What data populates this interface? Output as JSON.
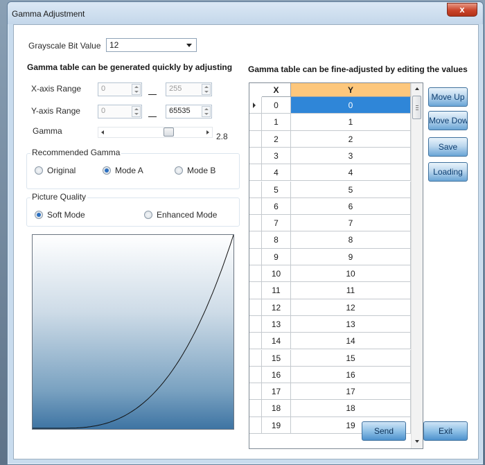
{
  "window": {
    "title": "Gamma Adjustment",
    "close_symbol": "x"
  },
  "grayscale": {
    "label": "Grayscale Bit Value",
    "value": "12"
  },
  "left_heading": "Gamma table can be generated quickly by adjusting",
  "x_axis": {
    "label": "X-axis Range",
    "min": "0",
    "max": "255"
  },
  "y_axis": {
    "label": "Y-axis Range",
    "min": "0",
    "max": "65535"
  },
  "gamma": {
    "label": "Gamma",
    "value": "2.8",
    "slider_fraction": 0.61
  },
  "recommended": {
    "title": "Recommended Gamma",
    "options": [
      {
        "label": "Original",
        "selected": false
      },
      {
        "label": "Mode A",
        "selected": true
      },
      {
        "label": "Mode B",
        "selected": false
      }
    ]
  },
  "quality": {
    "title": "Picture Quality",
    "options": [
      {
        "label": "Soft Mode",
        "selected": true
      },
      {
        "label": "Enhanced Mode",
        "selected": false
      }
    ]
  },
  "right_heading": "Gamma table can be fine-adjusted by editing the values",
  "table": {
    "headers": [
      "X",
      "Y"
    ],
    "rows": [
      [
        "0",
        "0"
      ],
      [
        "1",
        "1"
      ],
      [
        "2",
        "2"
      ],
      [
        "3",
        "3"
      ],
      [
        "4",
        "4"
      ],
      [
        "5",
        "5"
      ],
      [
        "6",
        "6"
      ],
      [
        "7",
        "7"
      ],
      [
        "8",
        "8"
      ],
      [
        "9",
        "9"
      ],
      [
        "10",
        "10"
      ],
      [
        "11",
        "11"
      ],
      [
        "12",
        "12"
      ],
      [
        "13",
        "13"
      ],
      [
        "14",
        "14"
      ],
      [
        "15",
        "15"
      ],
      [
        "16",
        "16"
      ],
      [
        "17",
        "17"
      ],
      [
        "18",
        "18"
      ],
      [
        "19",
        "19"
      ]
    ]
  },
  "side_buttons": {
    "move_up": "Move Up",
    "move_down": "Move Down",
    "save": "Save",
    "loading": "Loading"
  },
  "bottom_buttons": {
    "send": "Send",
    "exit": "Exit"
  }
}
